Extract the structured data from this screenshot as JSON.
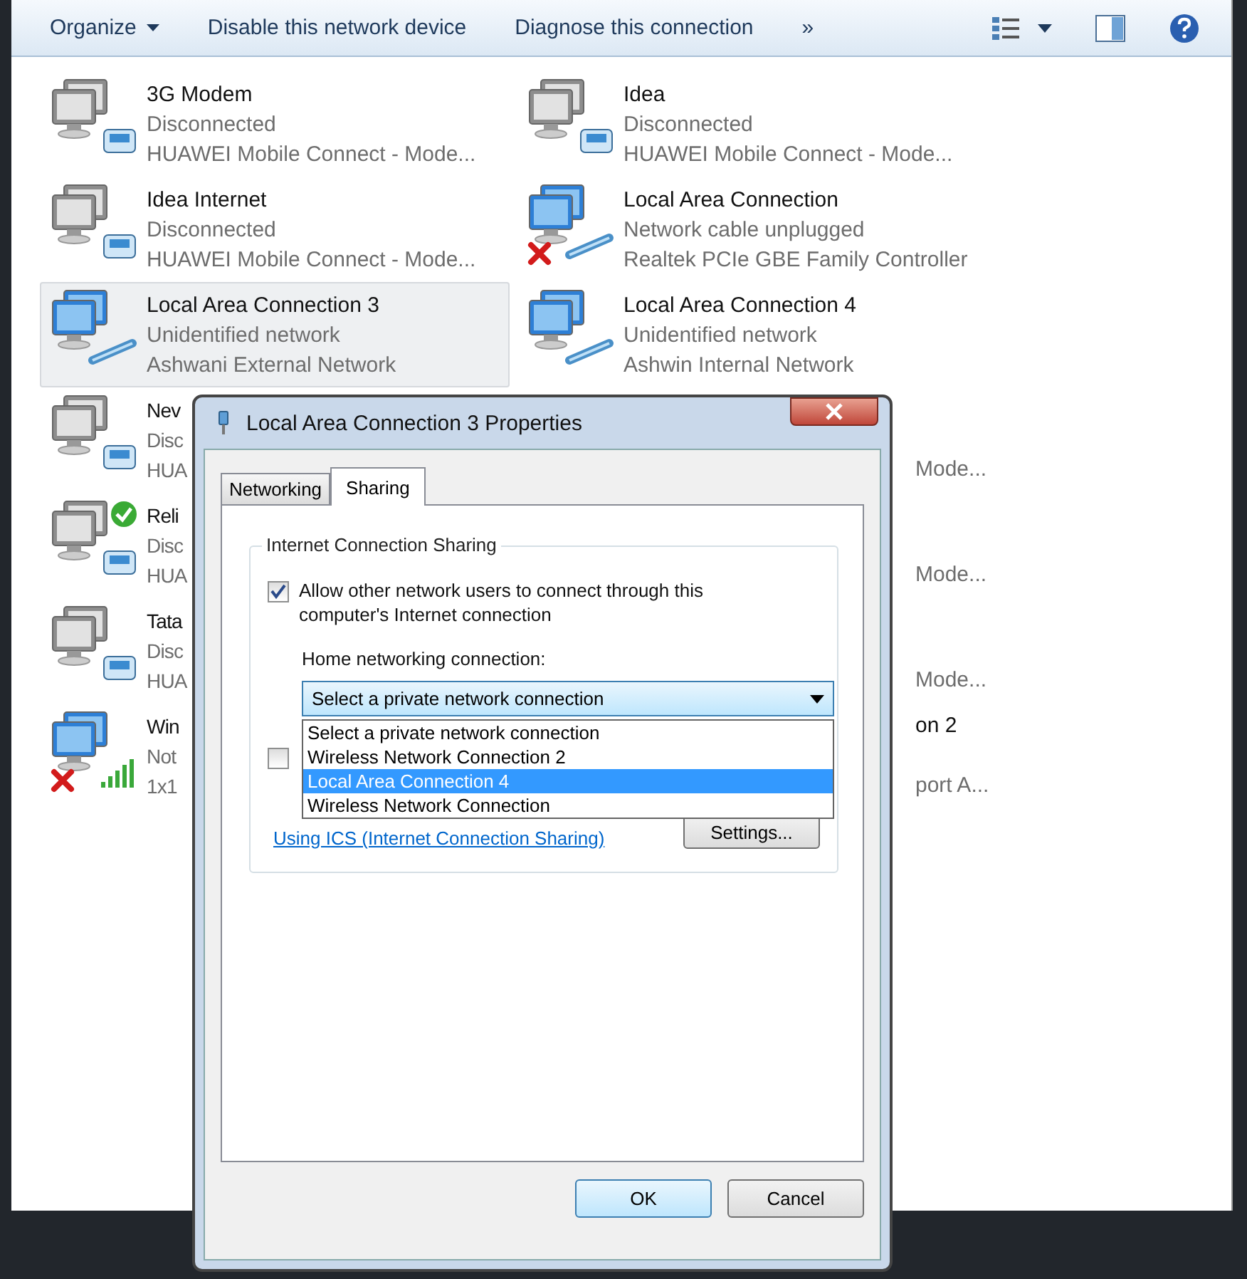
{
  "toolbar": {
    "items": [
      {
        "label": "Organize",
        "kind": "menu"
      },
      {
        "label": "Disable this network device",
        "kind": "command"
      },
      {
        "label": "Diagnose this connection",
        "kind": "command"
      },
      {
        "label": "»",
        "kind": "command"
      }
    ]
  },
  "connections": [
    {
      "name": "3G Modem",
      "status": "Disconnected",
      "device": "HUAWEI Mobile Connect - Mode...",
      "kind": "modem",
      "error": false,
      "default": false,
      "selected": false
    },
    {
      "name": "Idea",
      "status": "Disconnected",
      "device": "HUAWEI Mobile Connect - Mode...",
      "kind": "modem",
      "error": false,
      "default": false,
      "selected": false
    },
    {
      "name": "Idea Internet",
      "status": "Disconnected",
      "device": "HUAWEI Mobile Connect - Mode...",
      "kind": "modem",
      "error": false,
      "default": false,
      "selected": false
    },
    {
      "name": "Local Area Connection",
      "status": "Network cable unplugged",
      "device": "Realtek PCIe GBE Family Controller",
      "kind": "lan",
      "error": true,
      "default": false,
      "selected": false
    },
    {
      "name": "Local Area Connection 3",
      "status": "Unidentified network",
      "device": "Ashwani External Network",
      "kind": "lan",
      "error": false,
      "default": false,
      "selected": true
    },
    {
      "name": "Local Area Connection 4",
      "status": "Unidentified network",
      "device": "Ashwin Internal Network",
      "kind": "lan",
      "error": false,
      "default": false,
      "selected": false
    }
  ],
  "covered_connections": [
    {
      "name": "Nev",
      "status": "Disc",
      "device": "HUA",
      "kind": "modem",
      "error": false,
      "default": false
    },
    {
      "name": "Reli",
      "status": "Disc",
      "device": "HUA",
      "kind": "modem",
      "error": false,
      "default": true
    },
    {
      "name": "Tata",
      "status": "Disc",
      "device": "HUA",
      "kind": "modem",
      "error": false,
      "default": false
    },
    {
      "name": "Win",
      "status": "Not",
      "device": "1x1",
      "kind": "wireless",
      "error": true,
      "default": false
    }
  ],
  "covered_right_fragments": [
    {
      "device": "Mode..."
    },
    {
      "device": "Mode..."
    },
    {
      "device": "Mode..."
    },
    {
      "name": "on 2",
      "device": "port A..."
    }
  ],
  "dialog": {
    "title": "Local Area Connection 3 Properties",
    "tabs": [
      {
        "label": "Networking",
        "selected": false
      },
      {
        "label": "Sharing",
        "selected": true
      }
    ],
    "group_title": "Internet Connection Sharing",
    "allow_sharing": {
      "label": "Allow other network users to connect through this computer's Internet connection",
      "checked": true
    },
    "home_label": "Home networking connection:",
    "home_combo": {
      "value": "Select a private network connection",
      "expanded": true
    },
    "home_options": [
      {
        "label": "Select a private network connection",
        "selected": false
      },
      {
        "label": "Wireless Network Connection 2",
        "selected": false
      },
      {
        "label": "Local Area Connection 4",
        "selected": true
      },
      {
        "label": "Wireless Network Connection",
        "selected": false
      }
    ],
    "second_checkbox": {
      "checked": false
    },
    "link": "Using ICS (Internet Connection Sharing)",
    "settings_button": "Settings...",
    "buttons": [
      "OK",
      "Cancel"
    ]
  }
}
